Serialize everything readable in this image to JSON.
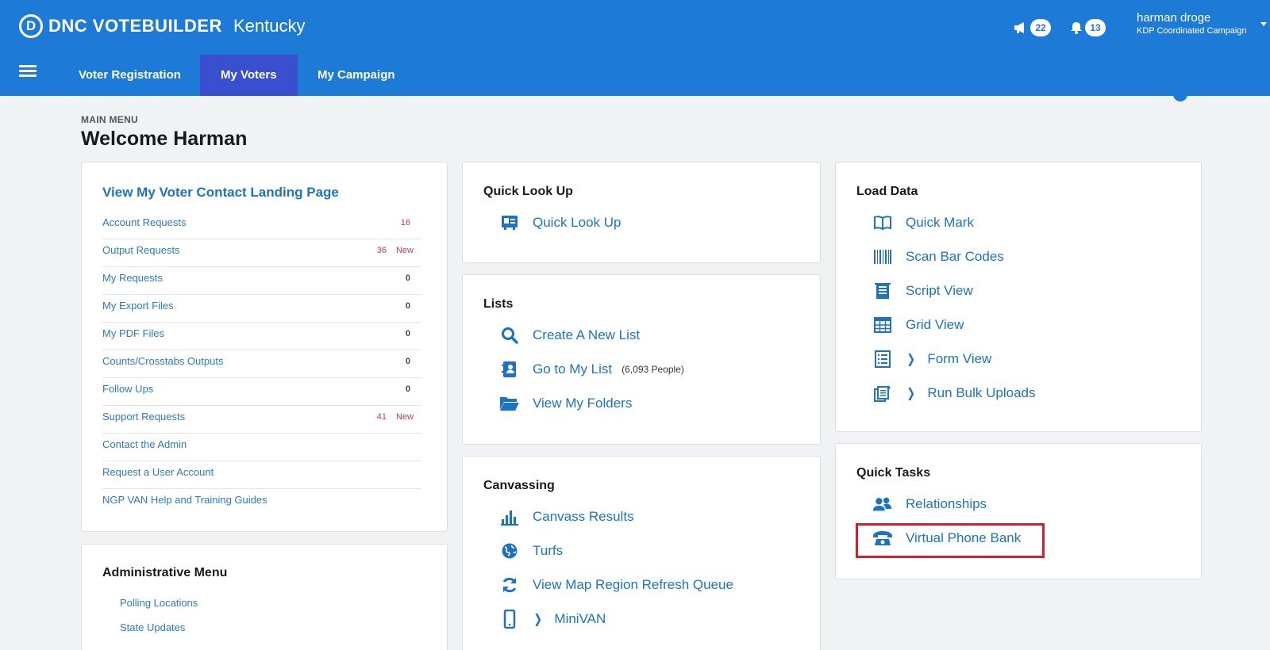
{
  "header": {
    "brand_initial": "D",
    "brand_name": "DNC VOTEBUILDER",
    "state": "Kentucky",
    "notifications": {
      "announcements_count": "22",
      "alerts_count": "13"
    },
    "user": {
      "name": "harman droge",
      "org": "KDP Coordinated Campaign"
    },
    "nav_tabs": [
      {
        "label": "Voter Registration"
      },
      {
        "label": "My Voters"
      },
      {
        "label": "My Campaign"
      }
    ],
    "active_tab": "My Voters"
  },
  "page": {
    "breadcrumb": "MAIN MENU",
    "title": "Welcome Harman"
  },
  "voter_contact": {
    "title": "View My Voter Contact Landing Page",
    "rows": [
      {
        "label": "Account Requests",
        "count": "16",
        "new": ""
      },
      {
        "label": "Output Requests",
        "count": "36",
        "new": "New"
      },
      {
        "label": "My Requests",
        "count": "0",
        "new": ""
      },
      {
        "label": "My Export Files",
        "count": "0",
        "new": ""
      },
      {
        "label": "My PDF Files",
        "count": "0",
        "new": ""
      },
      {
        "label": "Counts/Crosstabs Outputs",
        "count": "0",
        "new": ""
      },
      {
        "label": "Follow Ups",
        "count": "0",
        "new": ""
      },
      {
        "label": "Support Requests",
        "count": "41",
        "new": "New"
      },
      {
        "label": "Contact the Admin",
        "count": "",
        "new": ""
      },
      {
        "label": "Request a User Account",
        "count": "",
        "new": ""
      },
      {
        "label": "NGP VAN Help and Training Guides",
        "count": "",
        "new": ""
      }
    ]
  },
  "admin_menu": {
    "title": "Administrative Menu",
    "items": [
      "Polling Locations",
      "State Updates"
    ]
  },
  "quick_lookup": {
    "title": "Quick Look Up",
    "items": [
      {
        "label": "Quick Look Up",
        "icon": "id-card-icon"
      }
    ]
  },
  "lists": {
    "title": "Lists",
    "items": [
      {
        "label": "Create A New List",
        "icon": "search-icon"
      },
      {
        "label": "Go to My List",
        "icon": "contact-book-icon",
        "note": "(6,093 People)"
      },
      {
        "label": "View My Folders",
        "icon": "folder-open-icon"
      }
    ]
  },
  "canvassing": {
    "title": "Canvassing",
    "items": [
      {
        "label": "Canvass Results",
        "icon": "bar-chart-icon"
      },
      {
        "label": "Turfs",
        "icon": "globe-icon"
      },
      {
        "label": "View Map Region Refresh Queue",
        "icon": "refresh-icon"
      },
      {
        "label": "MiniVAN",
        "icon": "mobile-phone-icon"
      }
    ]
  },
  "load_data": {
    "title": "Load Data",
    "items": [
      {
        "label": "Quick Mark",
        "icon": "book-icon"
      },
      {
        "label": "Scan Bar Codes",
        "icon": "barcode-icon"
      },
      {
        "label": "Script View",
        "icon": "script-icon"
      },
      {
        "label": "Grid View",
        "icon": "grid-icon"
      },
      {
        "label": "Form View",
        "icon": "form-list-icon"
      },
      {
        "label": "Run Bulk Uploads",
        "icon": "bulk-upload-icon"
      }
    ]
  },
  "quick_tasks": {
    "title": "Quick Tasks",
    "items": [
      {
        "label": "Relationships",
        "icon": "users-icon"
      },
      {
        "label": "Virtual Phone Bank",
        "icon": "telephone-icon"
      }
    ]
  },
  "colors": {
    "header_blue": "#1d7ad6",
    "active_tab": "#3a4fcf",
    "link_blue": "#1d72c4",
    "alert_red": "#c93a4e",
    "highlight_red": "#d3202b"
  }
}
